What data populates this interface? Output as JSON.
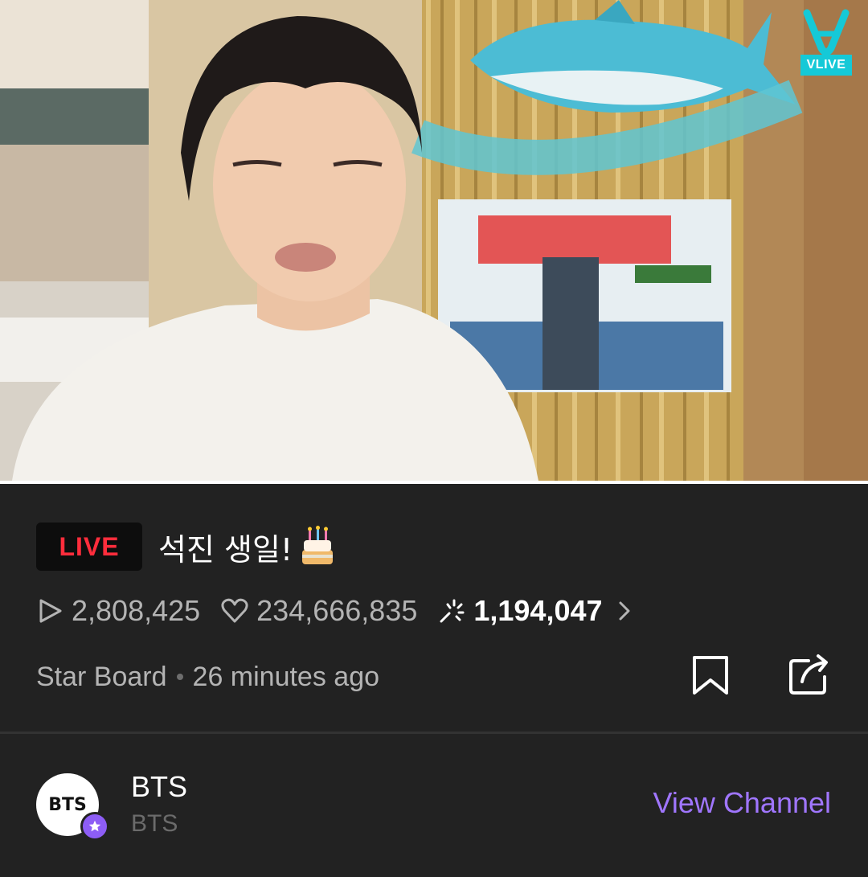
{
  "video": {
    "brand_label": "VLIVE",
    "icon": "vlive-logo-icon",
    "colors": {
      "brand": "#15c9d7"
    }
  },
  "broadcast": {
    "live_label": "LIVE",
    "title": "석진 생일!",
    "title_emoji_icon": "birthday-cake-icon",
    "plays": "2,808,425",
    "hearts": "234,666,835",
    "sparkles": "1,194,047",
    "board": "Star Board",
    "time_ago": "26 minutes ago"
  },
  "icons": {
    "play": "play-outline-icon",
    "heart": "heart-outline-icon",
    "sparkle": "sparkle-icon",
    "chevron": "chevron-right-icon",
    "bookmark": "bookmark-icon",
    "share": "share-icon"
  },
  "channel": {
    "avatar_text": "BTS",
    "name": "BTS",
    "subtitle": "BTS",
    "view_label": "View Channel",
    "colors": {
      "accent": "#a076ff",
      "live": "#ff2d3c"
    }
  }
}
